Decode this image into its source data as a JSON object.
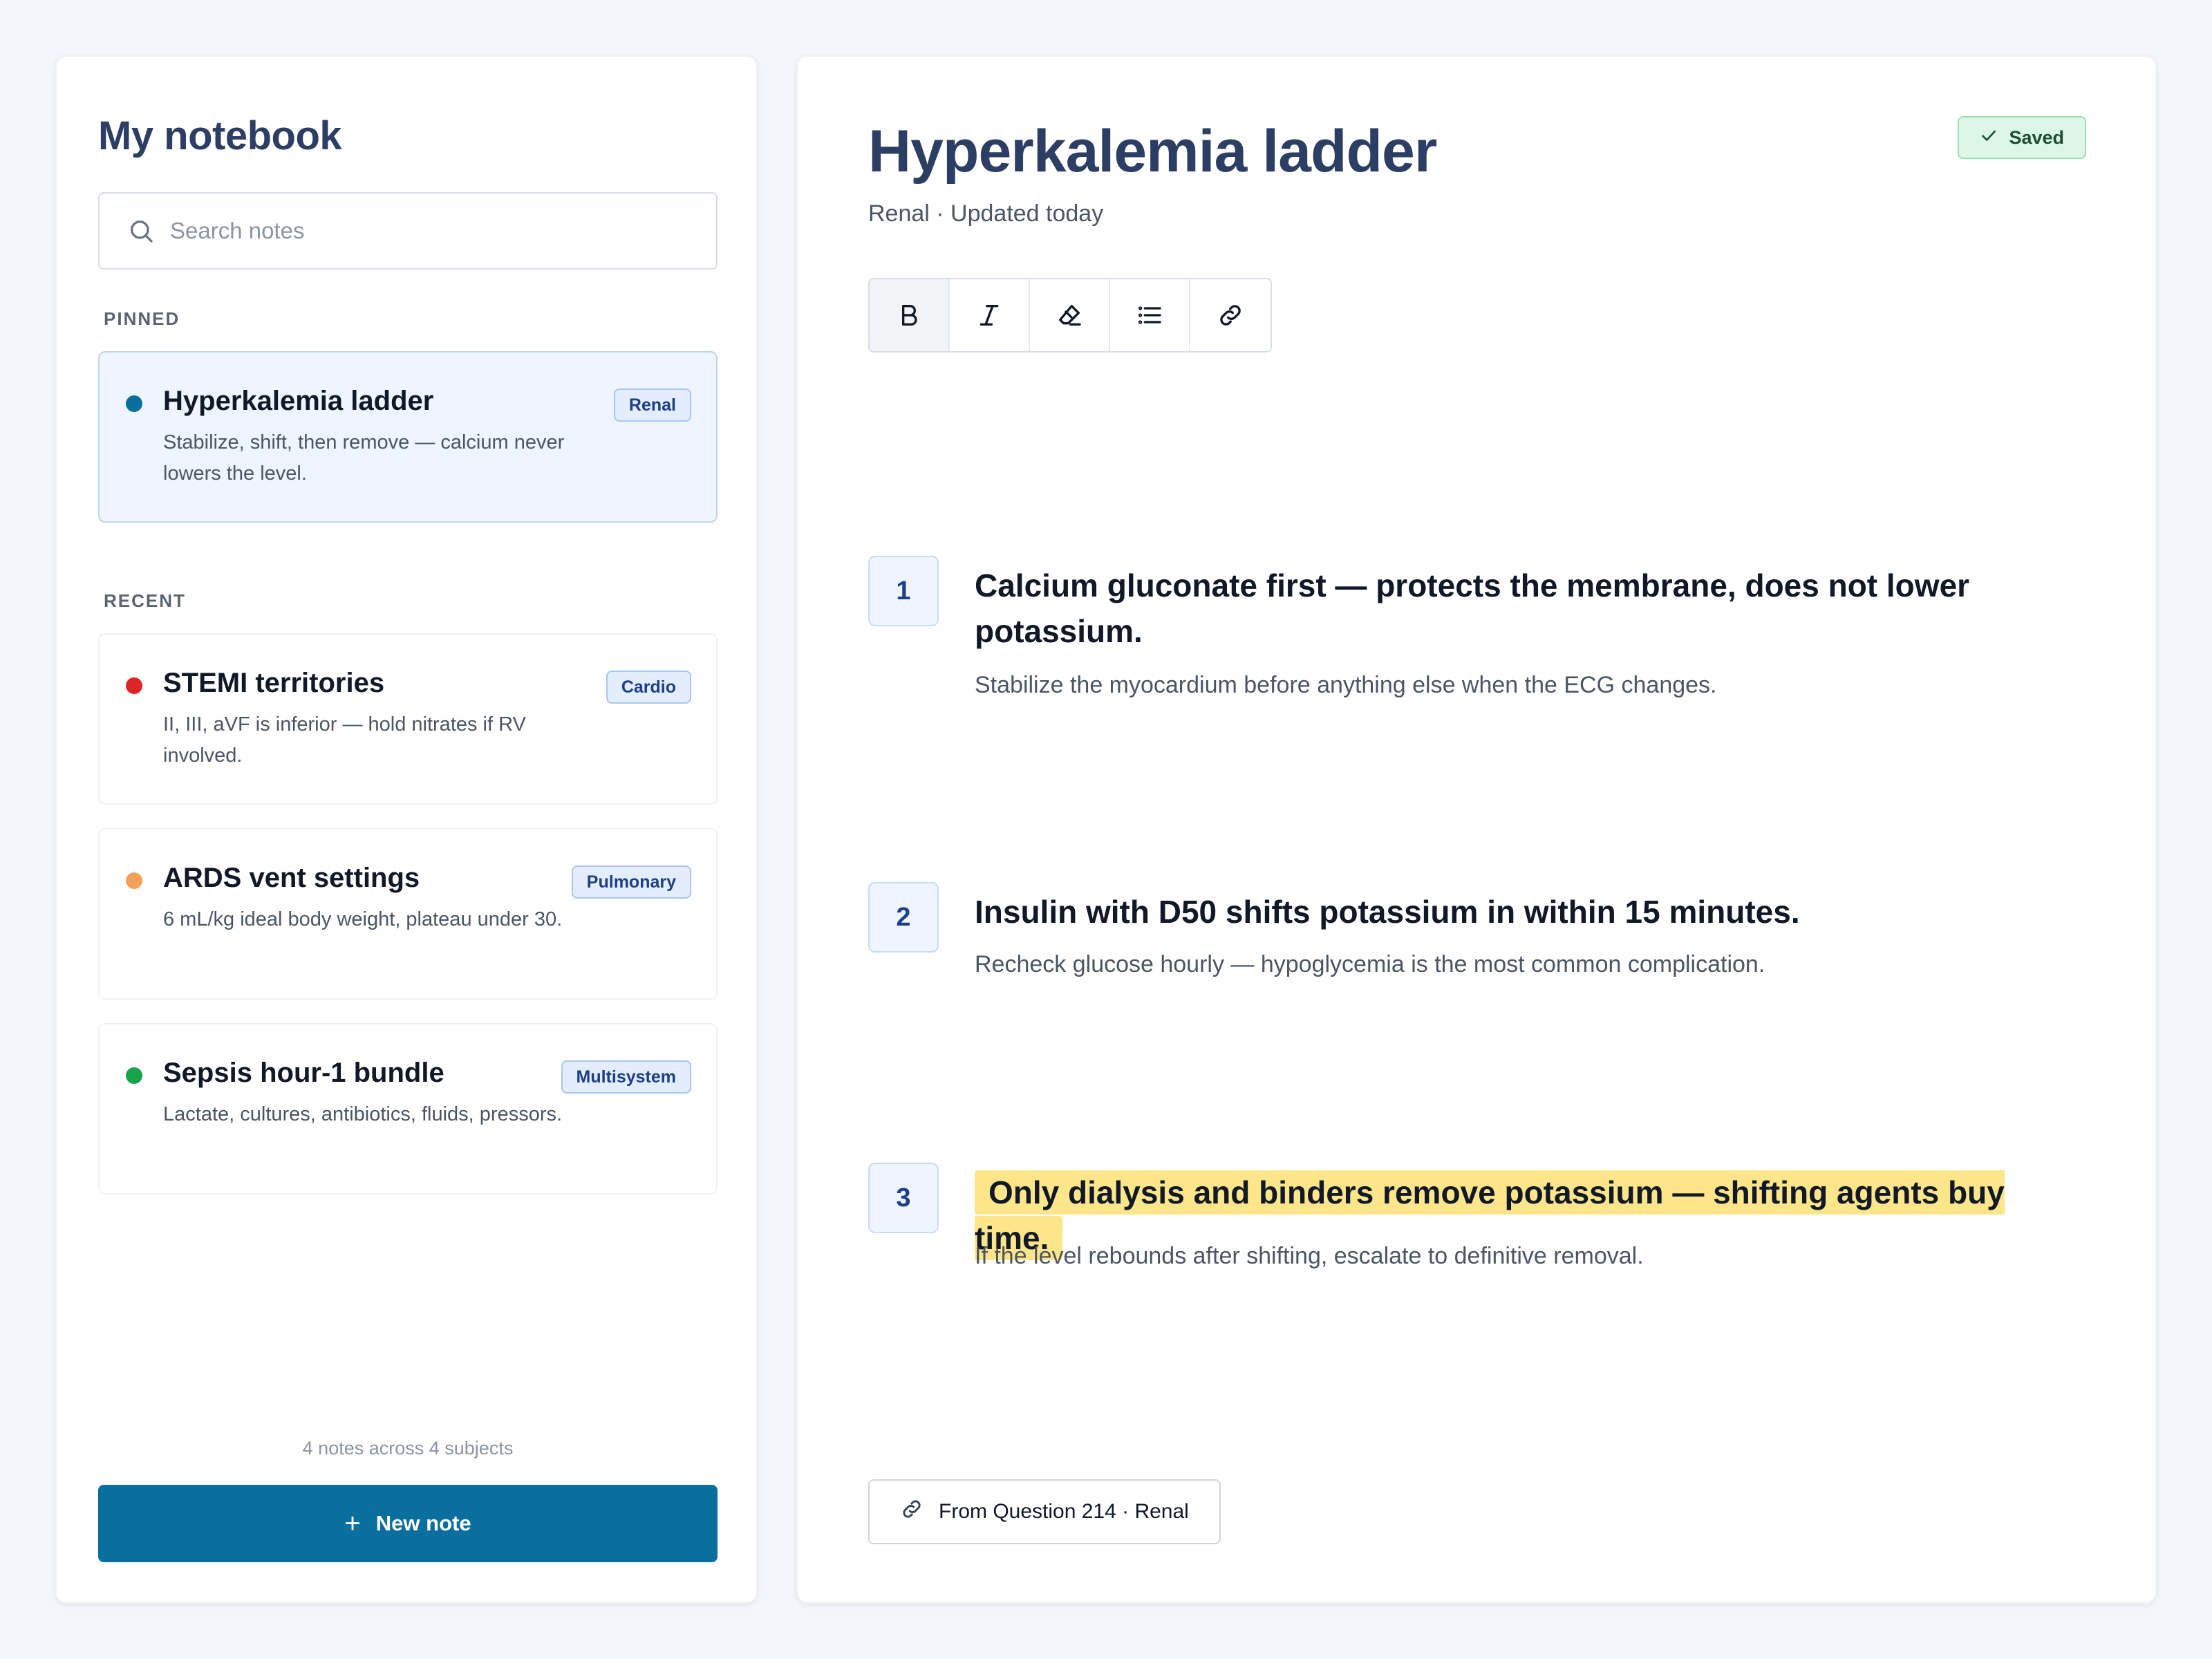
{
  "sidebar": {
    "title": "My notebook",
    "search": {
      "placeholder": "Search notes",
      "value": ""
    },
    "pinned_label": "PINNED",
    "recent_label": "RECENT",
    "pinned": [
      {
        "title": "Hyperkalemia ladder",
        "snippet": "Stabilize, shift, then remove — calcium never lowers the level.",
        "tag": "Renal",
        "dot_color": "#0b6f9e"
      }
    ],
    "recent": [
      {
        "title": "STEMI territories",
        "snippet": "II, III, aVF is inferior — hold nitrates if RV involved.",
        "tag": "Cardio",
        "dot_color": "#dc2626"
      },
      {
        "title": "ARDS vent settings",
        "snippet": "6 mL/kg ideal body weight, plateau under 30.",
        "tag": "Pulmonary",
        "dot_color": "#f5a05a"
      },
      {
        "title": "Sepsis hour-1 bundle",
        "snippet": "Lactate, cultures, antibiotics, fluids, pressors.",
        "tag": "Multisystem",
        "dot_color": "#16a34a"
      }
    ],
    "footer_count": "4 notes across 4 subjects",
    "new_note_icon": "+",
    "new_note_label": "New note"
  },
  "note": {
    "title": "Hyperkalemia ladder",
    "meta": "Renal · Updated today",
    "status": "Saved",
    "toolbar": [
      "bold-icon",
      "italic-icon",
      "highlighter-icon",
      "list-icon",
      "link-icon"
    ],
    "steps": [
      {
        "number": "1",
        "heading": "Calcium gluconate first — protects the membrane, does not lower potassium.",
        "detail": "Stabilize the myocardium before anything else when the ECG changes.",
        "highlighted": false
      },
      {
        "number": "2",
        "heading": "Insulin with D50 shifts potassium in within 15 minutes.",
        "detail": "Recheck glucose hourly — hypoglycemia is the most common complication.",
        "highlighted": false
      },
      {
        "number": "3",
        "heading": "Only dialysis and binders remove potassium — shifting agents buy time.",
        "detail": "If the level rebounds after shifting, escalate to definitive removal.",
        "highlighted": true
      }
    ],
    "source": "From Question 214 · Renal"
  },
  "colors": {
    "accent": "#0a6e9f",
    "title": "#2c3e63",
    "highlight": "#fde68a",
    "saved_bg": "#dcf7e6"
  }
}
